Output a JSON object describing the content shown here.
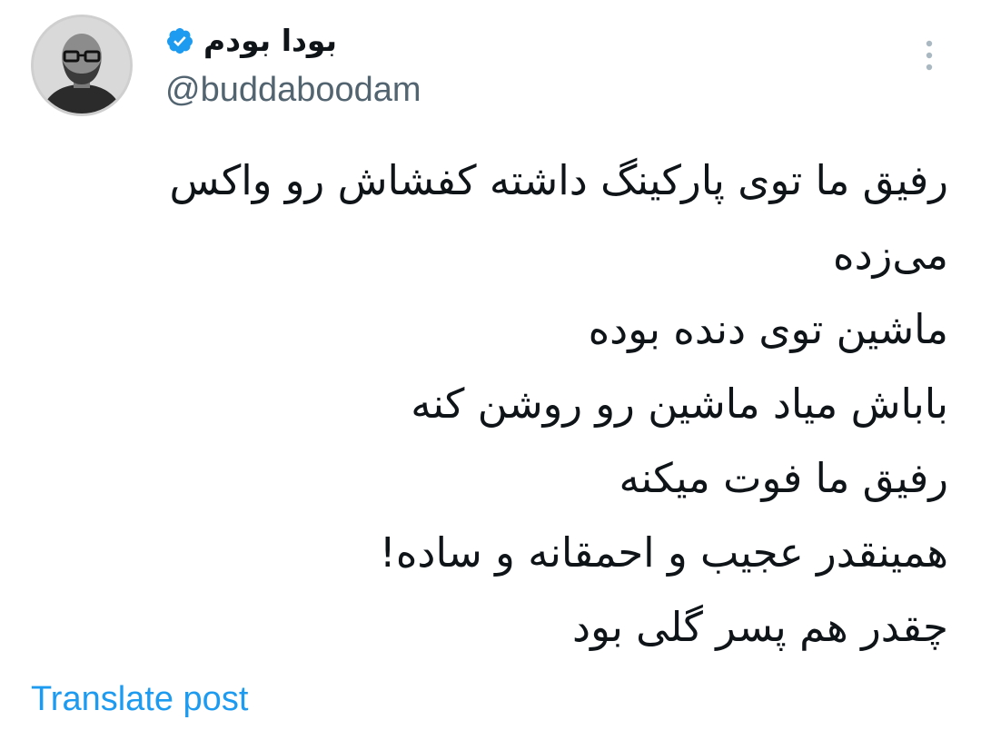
{
  "author": {
    "display_name": "بودا بودم",
    "handle": "@buddaboodam",
    "verified": true,
    "avatar_icon": "avatar-photo"
  },
  "menu": {
    "icon": "more-vertical-icon"
  },
  "post": {
    "lines": [
      "رفیق ما توی پارکینگ داشته کفشاش رو واکس می‌زده",
      "ماشین توی دنده بوده",
      "باباش میاد ماشین رو روشن کنه",
      "رفیق ما فوت میکنه",
      "همینقدر عجیب و احمقانه و ساده!",
      "چقدر هم پسر گلی بود"
    ]
  },
  "actions": {
    "translate_label": "Translate post"
  },
  "colors": {
    "text": "#0f1419",
    "secondary": "#536471",
    "link": "#1d9bf0",
    "verified": "#1d9bf0"
  }
}
